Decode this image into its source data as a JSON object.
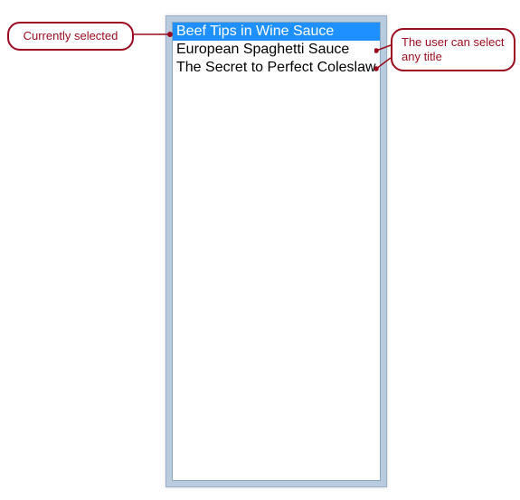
{
  "listbox": {
    "items": [
      {
        "label": "Beef Tips in Wine Sauce",
        "selected": true
      },
      {
        "label": "European Spaghetti Sauce",
        "selected": false
      },
      {
        "label": "The Secret to Perfect Coleslaw",
        "selected": false
      }
    ]
  },
  "annotations": {
    "left": {
      "text": "Currently selected"
    },
    "right": {
      "text": "The user can select any title"
    }
  },
  "colors": {
    "selection_bg": "#1e90ff",
    "selection_fg": "#ffffff",
    "frame_bg": "#b9cbde",
    "callout": "#9a0b1d"
  }
}
